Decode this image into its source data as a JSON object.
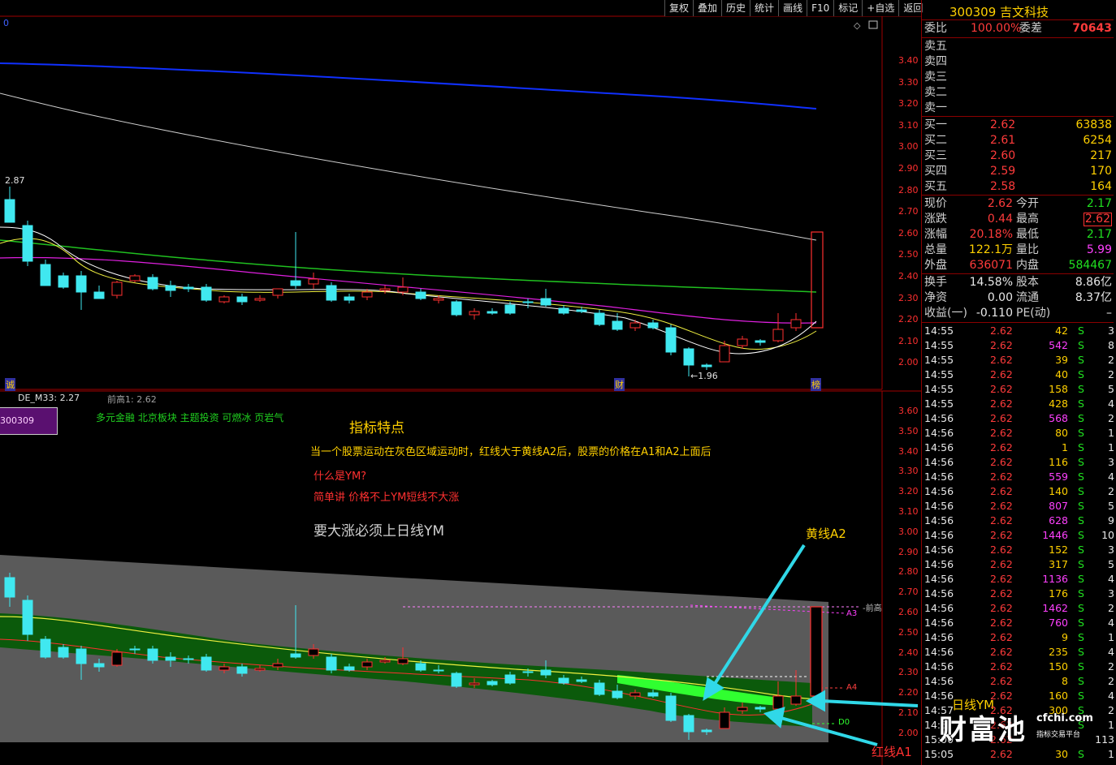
{
  "toolbar": [
    "复权",
    "叠加",
    "历史",
    "统计",
    "画线",
    "F10",
    "标记",
    "+自选",
    "返回"
  ],
  "stock": {
    "code": "300309",
    "name": "吉文科技"
  },
  "order_ratio": {
    "wb_label": "委比",
    "wb_value": "100.00%",
    "wc_label": "委差",
    "wc_value": "70643"
  },
  "sells": [
    "卖五",
    "卖四",
    "卖三",
    "卖二",
    "卖一"
  ],
  "buys": [
    {
      "label": "买一",
      "price": "2.62",
      "vol": "63838"
    },
    {
      "label": "买二",
      "price": "2.61",
      "vol": "6254"
    },
    {
      "label": "买三",
      "price": "2.60",
      "vol": "217"
    },
    {
      "label": "买四",
      "price": "2.59",
      "vol": "170"
    },
    {
      "label": "买五",
      "price": "2.58",
      "vol": "164"
    }
  ],
  "quote": [
    {
      "l1": "现价",
      "v1": "2.62",
      "c1": "red",
      "l2": "今开",
      "v2": "2.17",
      "c2": "grn"
    },
    {
      "l1": "涨跌",
      "v1": "0.44",
      "c1": "red",
      "l2": "最高",
      "v2": "2.62",
      "c2": "red"
    },
    {
      "l1": "涨幅",
      "v1": "20.18%",
      "c1": "red",
      "l2": "最低",
      "v2": "2.17",
      "c2": "grn"
    },
    {
      "l1": "总量",
      "v1": "122.1万",
      "c1": "yel",
      "l2": "量比",
      "v2": "5.99",
      "c2": "mag"
    },
    {
      "l1": "外盘",
      "v1": "636071",
      "c1": "red",
      "l2": "内盘",
      "v2": "584467",
      "c2": "grn"
    }
  ],
  "fin": [
    {
      "l1": "换手",
      "v1": "14.58%",
      "l2": "股本",
      "v2": "8.86亿"
    },
    {
      "l1": "净资",
      "v1": "0.00",
      "l2": "流通",
      "v2": "8.37亿"
    },
    {
      "l1": "收益(一)",
      "v1": "-0.110",
      "l2": "PE(动)",
      "v2": "–"
    }
  ],
  "ticks": [
    {
      "t": "14:55",
      "p": "2.62",
      "v": "42",
      "s": "S",
      "n": "3",
      "vc": "yel"
    },
    {
      "t": "14:55",
      "p": "2.62",
      "v": "542",
      "s": "S",
      "n": "8",
      "vc": "mag"
    },
    {
      "t": "14:55",
      "p": "2.62",
      "v": "39",
      "s": "S",
      "n": "2",
      "vc": "yel"
    },
    {
      "t": "14:55",
      "p": "2.62",
      "v": "40",
      "s": "S",
      "n": "2",
      "vc": "yel"
    },
    {
      "t": "14:55",
      "p": "2.62",
      "v": "158",
      "s": "S",
      "n": "5",
      "vc": "yel"
    },
    {
      "t": "14:55",
      "p": "2.62",
      "v": "428",
      "s": "S",
      "n": "4",
      "vc": "yel"
    },
    {
      "t": "14:56",
      "p": "2.62",
      "v": "568",
      "s": "S",
      "n": "2",
      "vc": "mag"
    },
    {
      "t": "14:56",
      "p": "2.62",
      "v": "80",
      "s": "S",
      "n": "1",
      "vc": "yel"
    },
    {
      "t": "14:56",
      "p": "2.62",
      "v": "1",
      "s": "S",
      "n": "1",
      "vc": "yel"
    },
    {
      "t": "14:56",
      "p": "2.62",
      "v": "116",
      "s": "S",
      "n": "3",
      "vc": "yel"
    },
    {
      "t": "14:56",
      "p": "2.62",
      "v": "559",
      "s": "S",
      "n": "4",
      "vc": "mag"
    },
    {
      "t": "14:56",
      "p": "2.62",
      "v": "140",
      "s": "S",
      "n": "2",
      "vc": "yel"
    },
    {
      "t": "14:56",
      "p": "2.62",
      "v": "807",
      "s": "S",
      "n": "5",
      "vc": "mag"
    },
    {
      "t": "14:56",
      "p": "2.62",
      "v": "628",
      "s": "S",
      "n": "9",
      "vc": "mag"
    },
    {
      "t": "14:56",
      "p": "2.62",
      "v": "1446",
      "s": "S",
      "n": "10",
      "vc": "mag"
    },
    {
      "t": "14:56",
      "p": "2.62",
      "v": "152",
      "s": "S",
      "n": "3",
      "vc": "yel"
    },
    {
      "t": "14:56",
      "p": "2.62",
      "v": "317",
      "s": "S",
      "n": "5",
      "vc": "yel"
    },
    {
      "t": "14:56",
      "p": "2.62",
      "v": "1136",
      "s": "S",
      "n": "4",
      "vc": "mag"
    },
    {
      "t": "14:56",
      "p": "2.62",
      "v": "176",
      "s": "S",
      "n": "3",
      "vc": "yel"
    },
    {
      "t": "14:56",
      "p": "2.62",
      "v": "1462",
      "s": "S",
      "n": "2",
      "vc": "mag"
    },
    {
      "t": "14:56",
      "p": "2.62",
      "v": "760",
      "s": "S",
      "n": "4",
      "vc": "mag"
    },
    {
      "t": "14:56",
      "p": "2.62",
      "v": "9",
      "s": "S",
      "n": "1",
      "vc": "yel"
    },
    {
      "t": "14:56",
      "p": "2.62",
      "v": "235",
      "s": "S",
      "n": "4",
      "vc": "yel"
    },
    {
      "t": "14:56",
      "p": "2.62",
      "v": "150",
      "s": "S",
      "n": "2",
      "vc": "yel"
    },
    {
      "t": "14:56",
      "p": "2.62",
      "v": "8",
      "s": "S",
      "n": "2",
      "vc": "yel"
    },
    {
      "t": "14:56",
      "p": "2.62",
      "v": "160",
      "s": "S",
      "n": "4",
      "vc": "yel"
    },
    {
      "t": "14:57",
      "p": "2.62",
      "v": "300",
      "s": "S",
      "n": "2",
      "vc": "yel"
    },
    {
      "t": "14:5",
      "p": "2.62",
      "v": "",
      "s": "S",
      "n": "1",
      "vc": "yel"
    },
    {
      "t": "15:00",
      "p": "2.62",
      "v": "",
      "s": "",
      "n": "113",
      "vc": "mag"
    },
    {
      "t": "15:05",
      "p": "2.62",
      "v": "30",
      "s": "S",
      "n": "1",
      "vc": "yel"
    }
  ],
  "top_axis": [
    "3.40",
    "3.30",
    "3.20",
    "3.10",
    "3.00",
    "2.90",
    "2.80",
    "2.70",
    "2.60",
    "2.50",
    "2.40",
    "2.30",
    "2.20",
    "2.10",
    "2.00"
  ],
  "bottom_axis": [
    "3.60",
    "3.50",
    "3.40",
    "3.30",
    "3.20",
    "3.10",
    "3.00",
    "2.90",
    "2.80",
    "2.70",
    "2.60",
    "2.50",
    "2.40",
    "2.30",
    "2.20",
    "2.10",
    "2.00"
  ],
  "top_chart": {
    "hi_label": "2.87",
    "lo_label": "1.96",
    "markers": [
      "诚",
      "财",
      "榜"
    ],
    "corner": "0"
  },
  "indicator": {
    "name": "DE_M33: 2.27",
    "prev_high": "前高1: 2.62",
    "code_box": "300309",
    "tags": "多元金融 北京板块 主题投资 可燃冰 页岩气"
  },
  "notes": {
    "title": "指标特点",
    "line1": "当一个股票运动在灰色区域运动时，红线大于黄线A2后，股票的价格在A1和A2上面后",
    "line2": "什么是YM?",
    "line3": "简单讲 价格不上YM短线不大涨",
    "line4": "要大涨必须上日线YM"
  },
  "labels": {
    "a2": "黄线A2",
    "ym": "日线YM",
    "a1": "红线A1",
    "prev": "-前高",
    "A3": "A3",
    "A4": "A4",
    "D0": "D0"
  },
  "watermark": {
    "main": "财富池",
    "site": "cfchi.com",
    "sub": "指标交易平台"
  }
}
